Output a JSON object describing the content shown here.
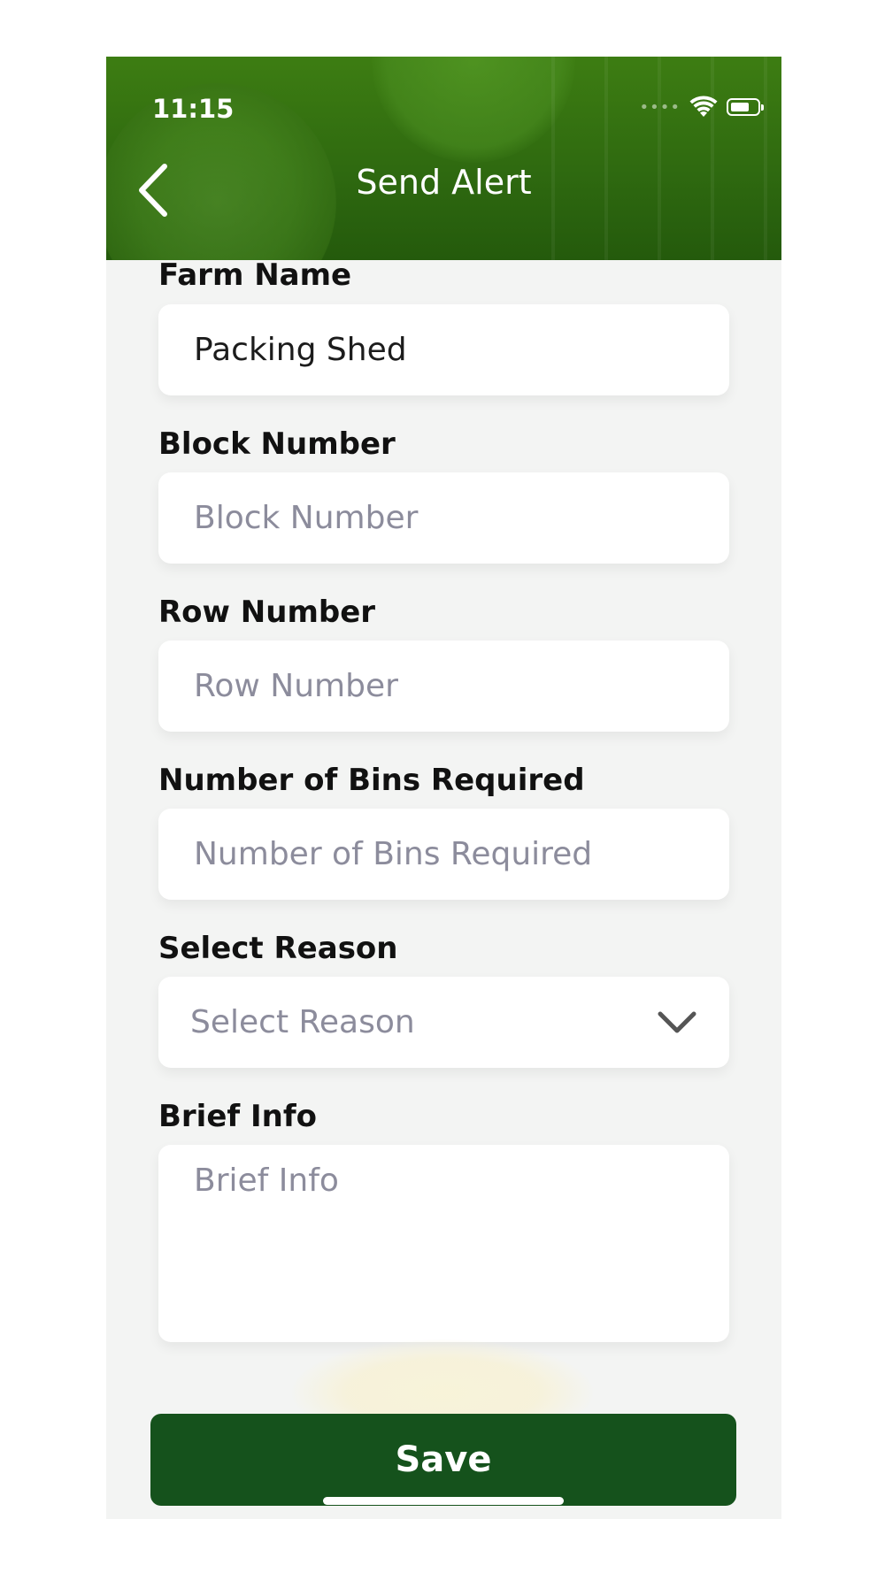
{
  "status_bar": {
    "time": "11:15",
    "signal": "••••"
  },
  "header": {
    "title": "Send Alert"
  },
  "fields": [
    {
      "label": "Farm Name",
      "value": "Packing Shed"
    },
    {
      "label": "Block Number",
      "placeholder": "Block Number"
    },
    {
      "label": "Row Number",
      "placeholder": "Row Number"
    },
    {
      "label": "Number of Bins Required",
      "placeholder": "Number of Bins Required"
    },
    {
      "label": "Select Reason",
      "placeholder": "Select Reason"
    },
    {
      "label": "Brief Info",
      "placeholder": "Brief Info"
    }
  ],
  "save_label": "Save",
  "icons": {
    "back": "chevron-left-icon",
    "dropdown": "chevron-down-icon",
    "wifi": "wifi-icon",
    "battery": "battery-icon"
  },
  "colors": {
    "header_green": "#2f6a10",
    "button_green": "#15521c",
    "placeholder": "#8c8c9c"
  }
}
